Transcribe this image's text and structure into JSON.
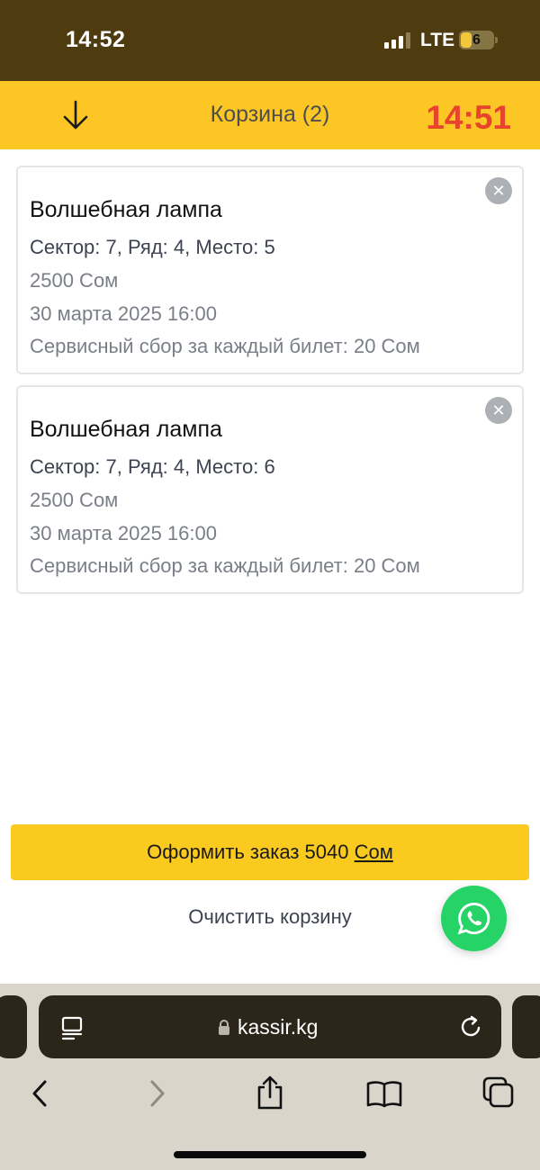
{
  "status_bar": {
    "time": "14:52",
    "network": "LTE",
    "battery_level": "6"
  },
  "header": {
    "back_icon": "arrow-down-icon",
    "title": "Корзина (2)",
    "timer": "14:51"
  },
  "cart": {
    "items": [
      {
        "title": "Волшебная лампа",
        "seat": "Сектор: 7, Ряд: 4, Место: 5",
        "price": "2500 Сом",
        "date": "30 марта 2025 16:00",
        "fee": "Сервисный сбор за каждый билет: 20 Сом",
        "remove_icon": "close-icon"
      },
      {
        "title": "Волшебная лампа",
        "seat": "Сектор: 7, Ряд: 4, Место: 6",
        "price": "2500 Сом",
        "date": "30 марта 2025 16:00",
        "fee": "Сервисный сбор за каждый билет: 20 Сом",
        "remove_icon": "close-icon"
      }
    ],
    "checkout_label": "Оформить заказ 5040",
    "checkout_currency": "Сом",
    "clear_label": "Очистить корзину"
  },
  "whatsapp": {
    "icon": "whatsapp-icon",
    "color": "#25d366"
  },
  "browser": {
    "url": "kassir.kg",
    "icons": [
      "reader-icon",
      "lock-icon",
      "reload-icon",
      "back-icon",
      "forward-icon",
      "share-icon",
      "bookmarks-icon",
      "tabs-icon"
    ]
  },
  "colors": {
    "header_bg": "#fcc725",
    "status_bg": "#4e3c10",
    "timer": "#e8432b",
    "checkout_bg": "#facb1e"
  }
}
